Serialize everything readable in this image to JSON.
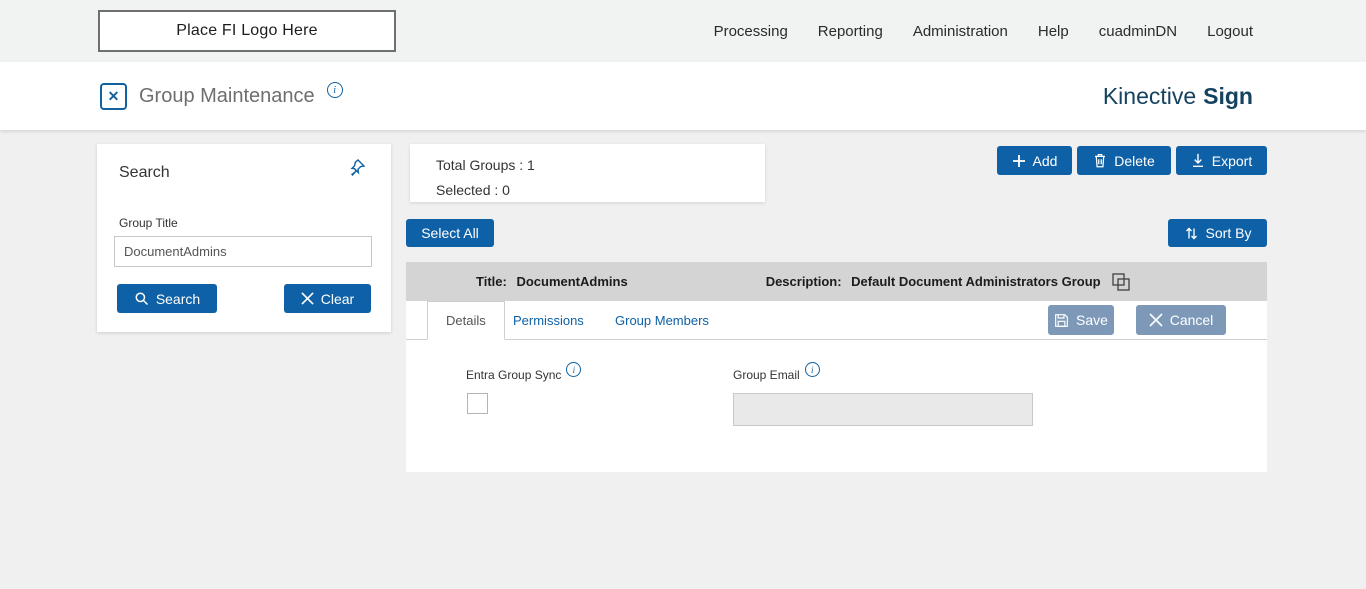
{
  "topbar": {
    "logo_placeholder": "Place FI Logo Here",
    "nav": [
      {
        "label": "Processing"
      },
      {
        "label": "Reporting"
      },
      {
        "label": "Administration"
      },
      {
        "label": "Help"
      },
      {
        "label": "cuadminDN"
      },
      {
        "label": "Logout"
      }
    ]
  },
  "header": {
    "page_title": "Group Maintenance",
    "brand_first": "Kinective",
    "brand_second": "Sign"
  },
  "search_panel": {
    "title": "Search",
    "group_title_label": "Group Title",
    "group_title_value": "DocumentAdmins",
    "search_button": "Search",
    "clear_button": "Clear"
  },
  "summary": {
    "total_groups": "Total Groups : 1",
    "selected": "Selected : 0"
  },
  "toolbar": {
    "add": "Add",
    "delete": "Delete",
    "export": "Export",
    "select_all": "Select All",
    "sort_by": "Sort By"
  },
  "group_row": {
    "title_label": "Title:",
    "title_value": "DocumentAdmins",
    "description_label": "Description:",
    "description_value": "Default Document Administrators Group"
  },
  "detail": {
    "tabs": [
      {
        "label": "Details"
      },
      {
        "label": "Permissions"
      },
      {
        "label": "Group Members"
      }
    ],
    "save_button": "Save",
    "cancel_button": "Cancel",
    "entra_group_sync_label": "Entra Group Sync",
    "entra_group_sync_checked": false,
    "group_email_label": "Group Email",
    "group_email_value": ""
  },
  "icons": {
    "page_title_icon": "x-square",
    "info_icon": "i-circle",
    "pin_icon": "pushpin",
    "search_icon": "magnifier",
    "clear_icon": "x",
    "add_icon": "plus",
    "delete_icon": "trash",
    "export_icon": "download-arrow",
    "sort_icon": "up-down-arrows",
    "copy_icon": "overlapping-squares",
    "save_icon": "floppy-disk",
    "cancel_icon": "x"
  },
  "colors": {
    "primary_blue": "#0e61a6",
    "muted_button": "#7e99b8",
    "brand_navy": "#14425f",
    "row_gray": "#d4d4d4",
    "background": "#f0f0f0"
  }
}
